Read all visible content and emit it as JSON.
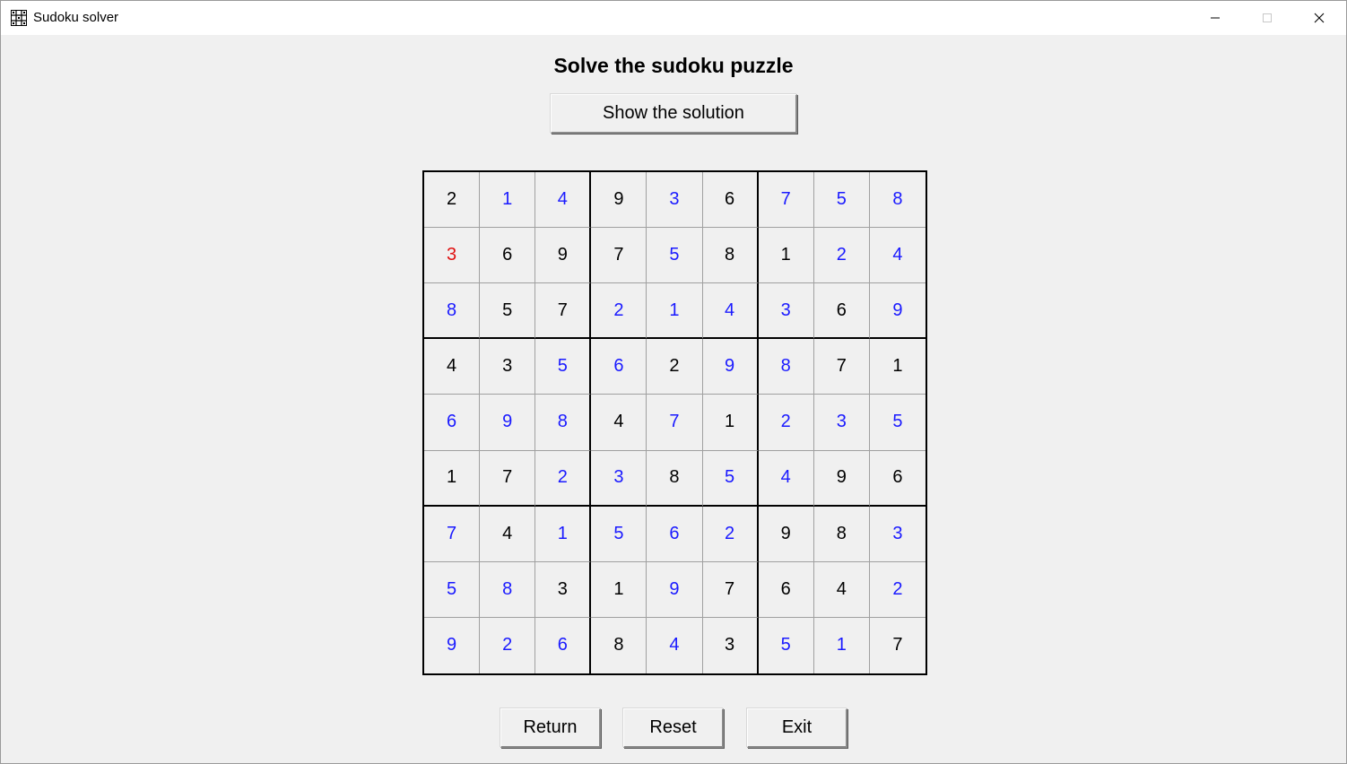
{
  "window": {
    "title": "Sudoku solver",
    "icon": "sudoku-grid-icon",
    "controls": [
      "minimize-icon",
      "maximize-icon",
      "close-icon"
    ]
  },
  "main": {
    "heading": "Solve the sudoku puzzle",
    "show_solution_label": "Show the solution"
  },
  "colors": {
    "given": "#000000",
    "solved": "#1a1aff",
    "error": "#e01010",
    "background": "#f0f0f0"
  },
  "grid": {
    "values": [
      [
        "2",
        "1",
        "4",
        "9",
        "3",
        "6",
        "7",
        "5",
        "8"
      ],
      [
        "3",
        "6",
        "9",
        "7",
        "5",
        "8",
        "1",
        "2",
        "4"
      ],
      [
        "8",
        "5",
        "7",
        "2",
        "1",
        "4",
        "3",
        "6",
        "9"
      ],
      [
        "4",
        "3",
        "5",
        "6",
        "2",
        "9",
        "8",
        "7",
        "1"
      ],
      [
        "6",
        "9",
        "8",
        "4",
        "7",
        "1",
        "2",
        "3",
        "5"
      ],
      [
        "1",
        "7",
        "2",
        "3",
        "8",
        "5",
        "4",
        "9",
        "6"
      ],
      [
        "7",
        "4",
        "1",
        "5",
        "6",
        "2",
        "9",
        "8",
        "3"
      ],
      [
        "5",
        "8",
        "3",
        "1",
        "9",
        "7",
        "6",
        "4",
        "2"
      ],
      [
        "9",
        "2",
        "6",
        "8",
        "4",
        "3",
        "5",
        "1",
        "7"
      ]
    ],
    "states": [
      [
        "given",
        "solved",
        "solved",
        "given",
        "solved",
        "given",
        "solved",
        "solved",
        "solved"
      ],
      [
        "error",
        "given",
        "given",
        "given",
        "solved",
        "given",
        "given",
        "solved",
        "solved"
      ],
      [
        "solved",
        "given",
        "given",
        "solved",
        "solved",
        "solved",
        "solved",
        "given",
        "solved"
      ],
      [
        "given",
        "given",
        "solved",
        "solved",
        "given",
        "solved",
        "solved",
        "given",
        "given"
      ],
      [
        "solved",
        "solved",
        "solved",
        "given",
        "solved",
        "given",
        "solved",
        "solved",
        "solved"
      ],
      [
        "given",
        "given",
        "solved",
        "solved",
        "given",
        "solved",
        "solved",
        "given",
        "given"
      ],
      [
        "solved",
        "given",
        "solved",
        "solved",
        "solved",
        "solved",
        "given",
        "given",
        "solved"
      ],
      [
        "solved",
        "solved",
        "given",
        "given",
        "solved",
        "given",
        "given",
        "given",
        "solved"
      ],
      [
        "solved",
        "solved",
        "solved",
        "given",
        "solved",
        "given",
        "solved",
        "solved",
        "given"
      ]
    ]
  },
  "footer": {
    "return_label": "Return",
    "reset_label": "Reset",
    "exit_label": "Exit"
  }
}
